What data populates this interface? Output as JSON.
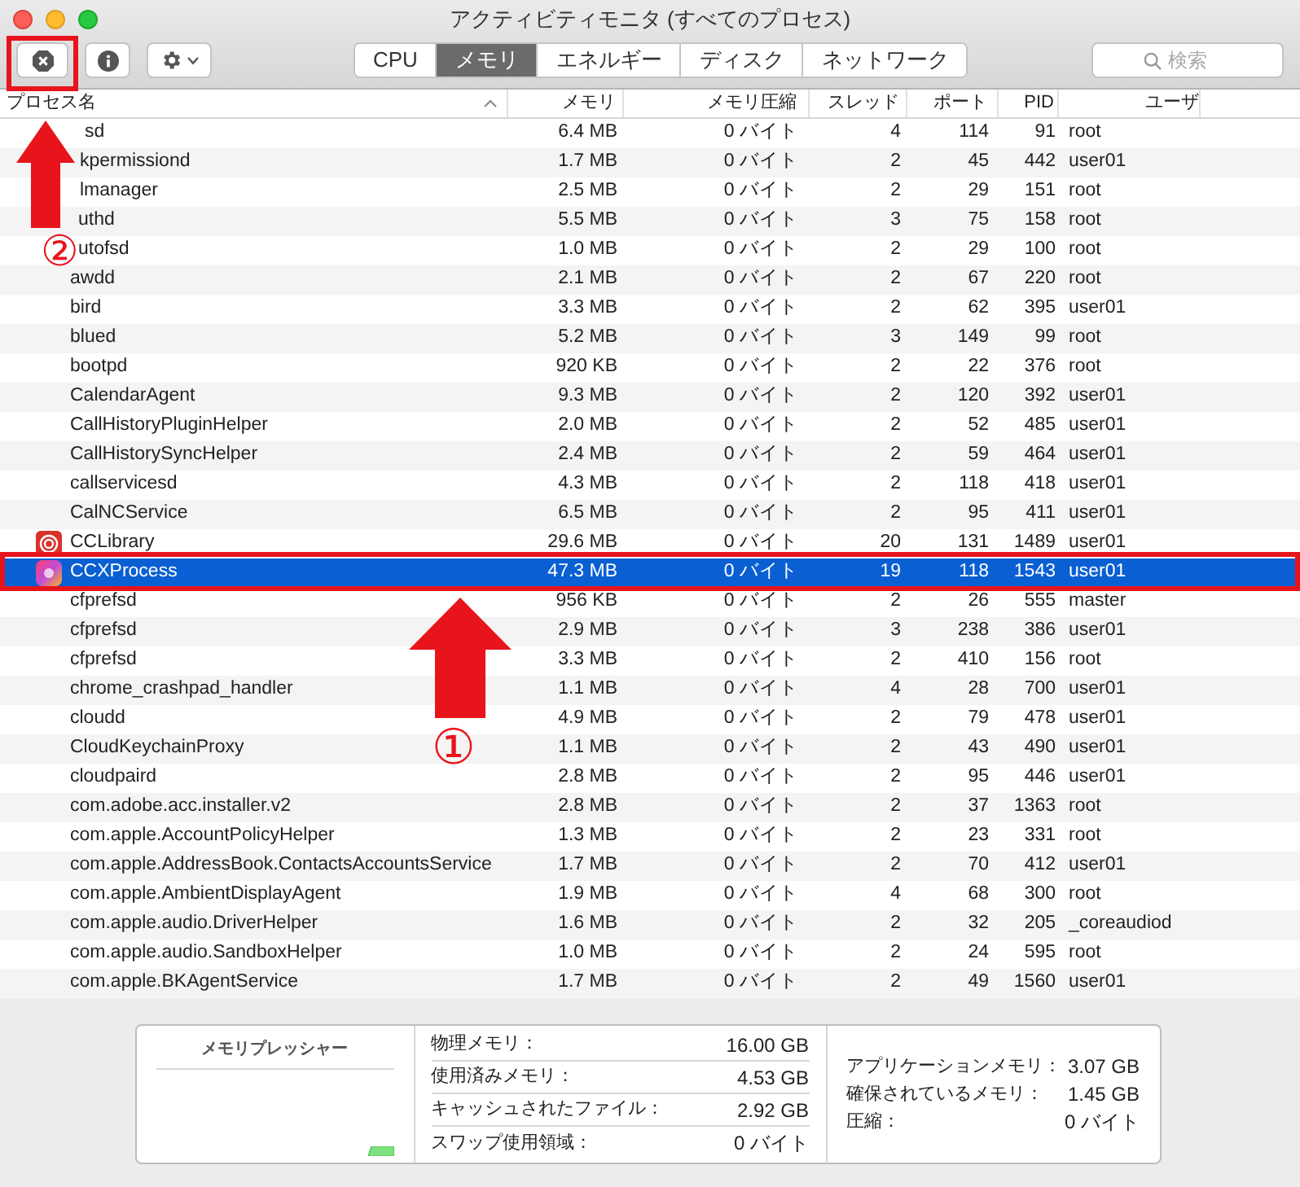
{
  "window": {
    "title": "アクティビティモニタ (すべてのプロセス)"
  },
  "tabs": [
    {
      "label": "CPU",
      "selected": false
    },
    {
      "label": "メモリ",
      "selected": true
    },
    {
      "label": "エネルギー",
      "selected": false
    },
    {
      "label": "ディスク",
      "selected": false
    },
    {
      "label": "ネットワーク",
      "selected": false
    }
  ],
  "search": {
    "placeholder": "検索"
  },
  "columns": [
    "プロセス名",
    "メモリ",
    "メモリ圧縮",
    "スレッド",
    "ポート",
    "PID",
    "ユーザ"
  ],
  "rows": [
    {
      "name": "sd",
      "memory": "6.4 MB",
      "compressed": "0 バイト",
      "threads": "4",
      "ports": "114",
      "pid": "91",
      "user": "root",
      "selected": false
    },
    {
      "name": "kpermissiond",
      "memory": "1.7 MB",
      "compressed": "0 バイト",
      "threads": "2",
      "ports": "45",
      "pid": "442",
      "user": "user01",
      "selected": false
    },
    {
      "name": "lmanager",
      "memory": "2.5 MB",
      "compressed": "0 バイト",
      "threads": "2",
      "ports": "29",
      "pid": "151",
      "user": "root",
      "selected": false
    },
    {
      "name": "uthd",
      "memory": "5.5 MB",
      "compressed": "0 バイト",
      "threads": "3",
      "ports": "75",
      "pid": "158",
      "user": "root",
      "selected": false
    },
    {
      "name": "utofsd",
      "memory": "1.0 MB",
      "compressed": "0 バイト",
      "threads": "2",
      "ports": "29",
      "pid": "100",
      "user": "root",
      "selected": false
    },
    {
      "name": "awdd",
      "memory": "2.1 MB",
      "compressed": "0 バイト",
      "threads": "2",
      "ports": "67",
      "pid": "220",
      "user": "root",
      "selected": false
    },
    {
      "name": "bird",
      "memory": "3.3 MB",
      "compressed": "0 バイト",
      "threads": "2",
      "ports": "62",
      "pid": "395",
      "user": "user01",
      "selected": false
    },
    {
      "name": "blued",
      "memory": "5.2 MB",
      "compressed": "0 バイト",
      "threads": "3",
      "ports": "149",
      "pid": "99",
      "user": "root",
      "selected": false
    },
    {
      "name": "bootpd",
      "memory": "920 KB",
      "compressed": "0 バイト",
      "threads": "2",
      "ports": "22",
      "pid": "376",
      "user": "root",
      "selected": false
    },
    {
      "name": "CalendarAgent",
      "memory": "9.3 MB",
      "compressed": "0 バイト",
      "threads": "2",
      "ports": "120",
      "pid": "392",
      "user": "user01",
      "selected": false
    },
    {
      "name": "CallHistoryPluginHelper",
      "memory": "2.0 MB",
      "compressed": "0 バイト",
      "threads": "2",
      "ports": "52",
      "pid": "485",
      "user": "user01",
      "selected": false
    },
    {
      "name": "CallHistorySyncHelper",
      "memory": "2.4 MB",
      "compressed": "0 バイト",
      "threads": "2",
      "ports": "59",
      "pid": "464",
      "user": "user01",
      "selected": false
    },
    {
      "name": "callservicesd",
      "memory": "4.3 MB",
      "compressed": "0 バイト",
      "threads": "2",
      "ports": "118",
      "pid": "418",
      "user": "user01",
      "selected": false
    },
    {
      "name": "CalNCService",
      "memory": "6.5 MB",
      "compressed": "0 バイト",
      "threads": "2",
      "ports": "95",
      "pid": "411",
      "user": "user01",
      "selected": false
    },
    {
      "name": "CCLibrary",
      "kind": "library",
      "memory": "29.6 MB",
      "compressed": "0 バイト",
      "threads": "20",
      "ports": "131",
      "pid": "1489",
      "user": "user01",
      "selected": false
    },
    {
      "name": "CCXProcess",
      "kind": "gradient",
      "memory": "47.3 MB",
      "compressed": "0 バイト",
      "threads": "19",
      "ports": "118",
      "pid": "1543",
      "user": "user01",
      "selected": true
    },
    {
      "name": "cfprefsd",
      "memory": "956 KB",
      "compressed": "0 バイト",
      "threads": "2",
      "ports": "26",
      "pid": "555",
      "user": "master",
      "selected": false
    },
    {
      "name": "cfprefsd",
      "memory": "2.9 MB",
      "compressed": "0 バイト",
      "threads": "3",
      "ports": "238",
      "pid": "386",
      "user": "user01",
      "selected": false
    },
    {
      "name": "cfprefsd",
      "memory": "3.3 MB",
      "compressed": "0 バイト",
      "threads": "2",
      "ports": "410",
      "pid": "156",
      "user": "root",
      "selected": false
    },
    {
      "name": "chrome_crashpad_handler",
      "memory": "1.1 MB",
      "compressed": "0 バイト",
      "threads": "4",
      "ports": "28",
      "pid": "700",
      "user": "user01",
      "selected": false
    },
    {
      "name": "cloudd",
      "memory": "4.9 MB",
      "compressed": "0 バイト",
      "threads": "2",
      "ports": "79",
      "pid": "478",
      "user": "user01",
      "selected": false
    },
    {
      "name": "CloudKeychainProxy",
      "memory": "1.1 MB",
      "compressed": "0 バイト",
      "threads": "2",
      "ports": "43",
      "pid": "490",
      "user": "user01",
      "selected": false
    },
    {
      "name": "cloudpaird",
      "memory": "2.8 MB",
      "compressed": "0 バイト",
      "threads": "2",
      "ports": "95",
      "pid": "446",
      "user": "user01",
      "selected": false
    },
    {
      "name": "com.adobe.acc.installer.v2",
      "memory": "2.8 MB",
      "compressed": "0 バイト",
      "threads": "2",
      "ports": "37",
      "pid": "1363",
      "user": "root",
      "selected": false
    },
    {
      "name": "com.apple.AccountPolicyHelper",
      "memory": "1.3 MB",
      "compressed": "0 バイト",
      "threads": "2",
      "ports": "23",
      "pid": "331",
      "user": "root",
      "selected": false
    },
    {
      "name": "com.apple.AddressBook.ContactsAccountsService",
      "memory": "1.7 MB",
      "compressed": "0 バイト",
      "threads": "2",
      "ports": "70",
      "pid": "412",
      "user": "user01",
      "selected": false
    },
    {
      "name": "com.apple.AmbientDisplayAgent",
      "memory": "1.9 MB",
      "compressed": "0 バイト",
      "threads": "4",
      "ports": "68",
      "pid": "300",
      "user": "root",
      "selected": false
    },
    {
      "name": "com.apple.audio.DriverHelper",
      "memory": "1.6 MB",
      "compressed": "0 バイト",
      "threads": "2",
      "ports": "32",
      "pid": "205",
      "user": "_coreaudiod",
      "selected": false
    },
    {
      "name": "com.apple.audio.SandboxHelper",
      "memory": "1.0 MB",
      "compressed": "0 バイト",
      "threads": "2",
      "ports": "24",
      "pid": "595",
      "user": "root",
      "selected": false
    },
    {
      "name": "com.apple.BKAgentService",
      "memory": "1.7 MB",
      "compressed": "0 バイト",
      "threads": "2",
      "ports": "49",
      "pid": "1560",
      "user": "user01",
      "selected": false
    }
  ],
  "memory_pressure": {
    "title": "メモリプレッシャー"
  },
  "memory_stats": [
    {
      "label": "物理メモリ：",
      "value": "16.00 GB"
    },
    {
      "label": "使用済みメモリ：",
      "value": "4.53 GB"
    },
    {
      "label": "キャッシュされたファイル：",
      "value": "2.92 GB"
    },
    {
      "label": "スワップ使用領域：",
      "value": "0 バイト"
    }
  ],
  "usage_stats": [
    {
      "label": "アプリケーションメモリ：",
      "value": "3.07 GB"
    },
    {
      "label": "確保されているメモリ：",
      "value": "1.45 GB"
    },
    {
      "label": "圧縮：",
      "value": "0 バイト"
    }
  ],
  "annotations": [
    {
      "text": "②"
    },
    {
      "text": "①"
    }
  ]
}
